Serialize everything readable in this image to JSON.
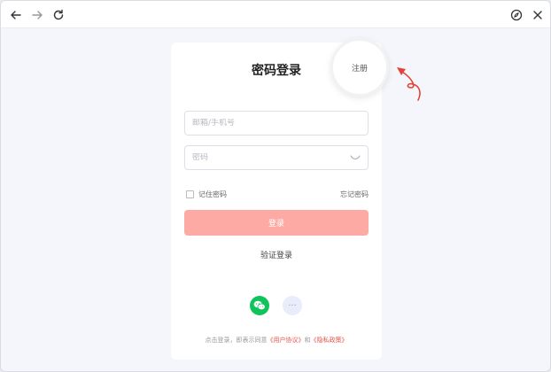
{
  "browser": {
    "back_icon": "arrow-left-icon",
    "forward_icon": "arrow-right-icon",
    "reload_icon": "reload-icon",
    "compass_icon": "compass-icon",
    "close_icon": "close-icon"
  },
  "login": {
    "title": "密码登录",
    "register_label": "注册",
    "email_placeholder": "邮箱/手机号",
    "password_placeholder": "密码",
    "remember_label": "记住密码",
    "forgot_label": "忘记密码",
    "login_button": "登录",
    "verify_login": "验证登录",
    "agreement_prefix": "点击登录，即表示同意",
    "user_agreement": "《用户协议》",
    "agreement_and": "和",
    "privacy_policy": "《隐私政策》"
  },
  "colors": {
    "accent": "#fdaaa4",
    "link": "#e5534b",
    "wechat": "#11c35b",
    "annotation_arrow": "#e0453a"
  }
}
